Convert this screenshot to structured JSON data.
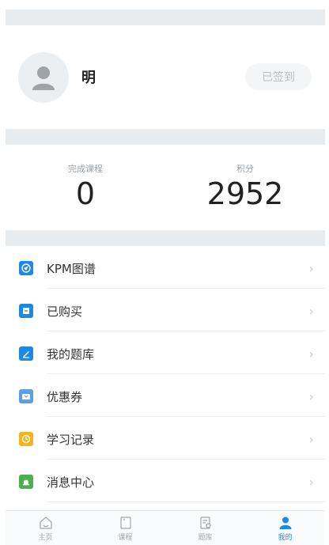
{
  "colors": {
    "accent": "#1e88e5",
    "kpm_icon": "#1e88e5",
    "purchased_icon": "#1e88e5",
    "question_bank_icon": "#1e88e5",
    "coupon_icon": "#5b9fe8",
    "study_record_icon": "#f6b31a",
    "message_icon": "#4caf50"
  },
  "profile": {
    "name": "明",
    "signin_label": "已签到",
    "avatar_icon": "user-silhouette-icon"
  },
  "stats": [
    {
      "label": "完成课程",
      "value": "0"
    },
    {
      "label": "积分",
      "value": "2952"
    }
  ],
  "menu": [
    {
      "label": "KPM图谱",
      "icon": "kpm-map-icon"
    },
    {
      "label": "已购买",
      "icon": "purchased-icon"
    },
    {
      "label": "我的题库",
      "icon": "question-bank-icon"
    },
    {
      "label": "优惠券",
      "icon": "coupon-icon"
    },
    {
      "label": "学习记录",
      "icon": "study-record-icon"
    },
    {
      "label": "消息中心",
      "icon": "message-center-icon"
    }
  ],
  "tabbar": [
    {
      "label": "主页",
      "icon": "home-icon",
      "active": false
    },
    {
      "label": "课程",
      "icon": "course-icon",
      "active": false
    },
    {
      "label": "题库",
      "icon": "question-bank-tab-icon",
      "active": false
    },
    {
      "label": "我的",
      "icon": "profile-tab-icon",
      "active": true
    }
  ]
}
